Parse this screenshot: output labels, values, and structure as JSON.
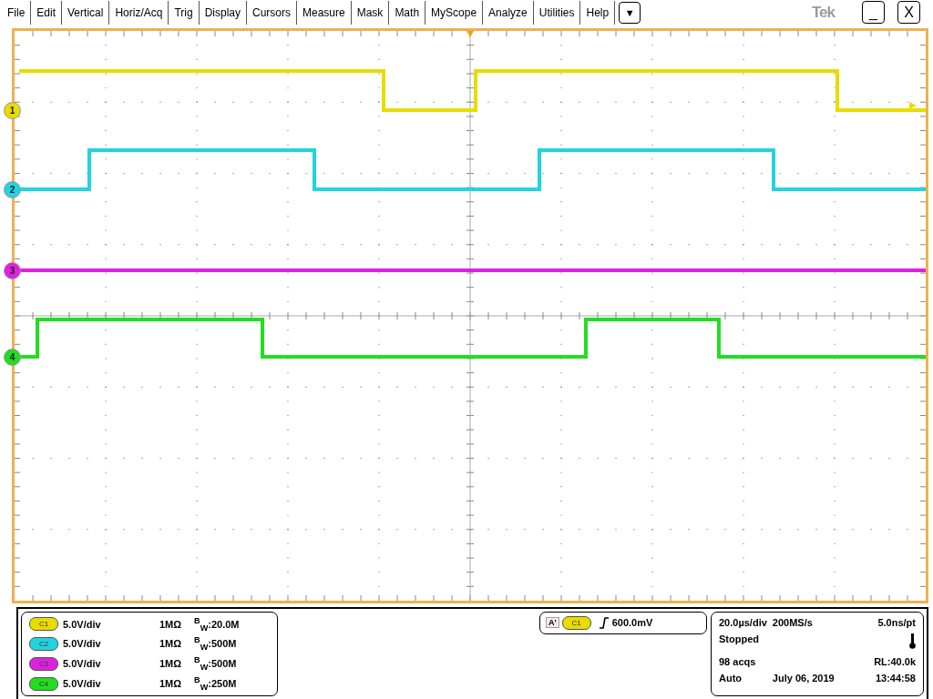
{
  "menu": {
    "items": [
      "File",
      "Edit",
      "Vertical",
      "Horiz/Acq",
      "Trig",
      "Display",
      "Cursors",
      "Measure",
      "Mask",
      "Math",
      "MyScope",
      "Analyze",
      "Utilities",
      "Help"
    ],
    "dropdown": "▼",
    "logo": "Tek",
    "window_buttons": [
      "_",
      "X"
    ]
  },
  "channels": [
    {
      "number": "1",
      "label": "C1",
      "color": "#e8dc00",
      "scale": "5.0V/div",
      "impedance": "1MΩ",
      "bandwidth": "$^{B}$$_{W}$:20.0M"
    },
    {
      "number": "2",
      "label": "C2",
      "color": "#22d3e0",
      "scale": "5.0V/div",
      "impedance": "1MΩ",
      "bandwidth": "$^{B}$$_{W}$:500M"
    },
    {
      "number": "3",
      "label": "C3",
      "color": "#dd22dd",
      "scale": "5.0V/div",
      "impedance": "1MΩ",
      "bandwidth": "$^{B}$$_{W}$:500M"
    },
    {
      "number": "4",
      "label": "C4",
      "color": "#22dd22",
      "scale": "5.0V/div",
      "impedance": "1MΩ",
      "bandwidth": "$^{B}$$_{W}$:250M"
    }
  ],
  "trigger": {
    "mode_tag": "A'",
    "channel": "C1",
    "color": "#e8dc00",
    "level": "600.0mV"
  },
  "timebase": {
    "scale": "20.0µs/div",
    "rate": "200MS/s",
    "resolution": "5.0ns/pt",
    "state": "Stopped",
    "acquisitions": "98 acqs",
    "record_length": "RL:40.0k",
    "mode": "Auto",
    "date": "July 06, 2019",
    "time": "13:44:58"
  }
}
